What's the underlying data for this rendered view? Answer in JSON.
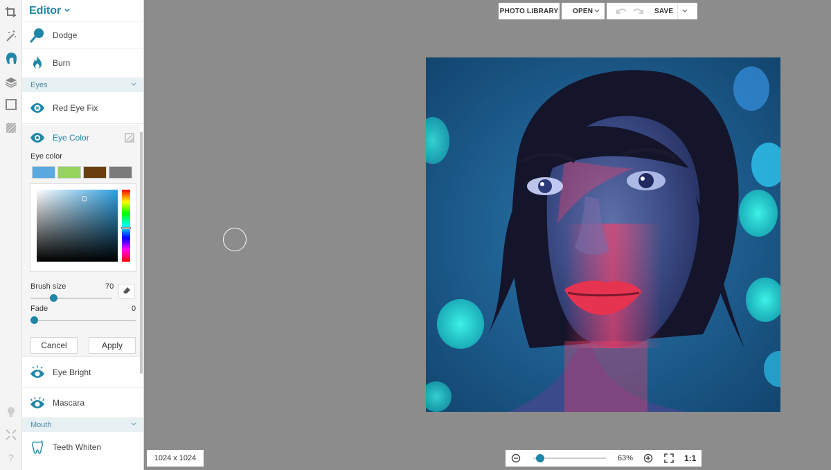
{
  "app": {
    "panel_title": "Editor"
  },
  "rail": {
    "icons": [
      "crop-icon",
      "magic-wand-icon",
      "touch-up-icon",
      "layers-icon",
      "frame-icon",
      "texture-icon",
      "lightbulb-icon",
      "expand-icon",
      "help-icon"
    ],
    "help_label": "?"
  },
  "tools": {
    "dodge": "Dodge",
    "burn": "Burn",
    "section_eyes": "Eyes",
    "red_eye_fix": "Red Eye Fix",
    "eye_color": "Eye Color",
    "eye_bright": "Eye Bright",
    "mascara": "Mascara",
    "section_mouth": "Mouth",
    "teeth_whiten": "Teeth Whiten"
  },
  "eye_color_panel": {
    "label": "Eye color",
    "swatches": [
      "#5aa9e0",
      "#96d45d",
      "#6a3f10",
      "#7b7b7b"
    ],
    "brush_size_label": "Brush size",
    "brush_size_value": "70",
    "brush_size_level": 0.28,
    "fade_label": "Fade",
    "fade_value": "0",
    "fade_level": 0.0,
    "cancel": "Cancel",
    "apply": "Apply"
  },
  "toolbar": {
    "photo_library": "PHOTO LIBRARY",
    "open": "OPEN",
    "save": "SAVE"
  },
  "status": {
    "dimensions": "1024 x 1024",
    "zoom": "63%",
    "zoom_level": 0.06,
    "one_to_one": "1:1"
  },
  "colors": {
    "accent": "#1f86a8",
    "canvas_bg": "#8c8c8c"
  }
}
